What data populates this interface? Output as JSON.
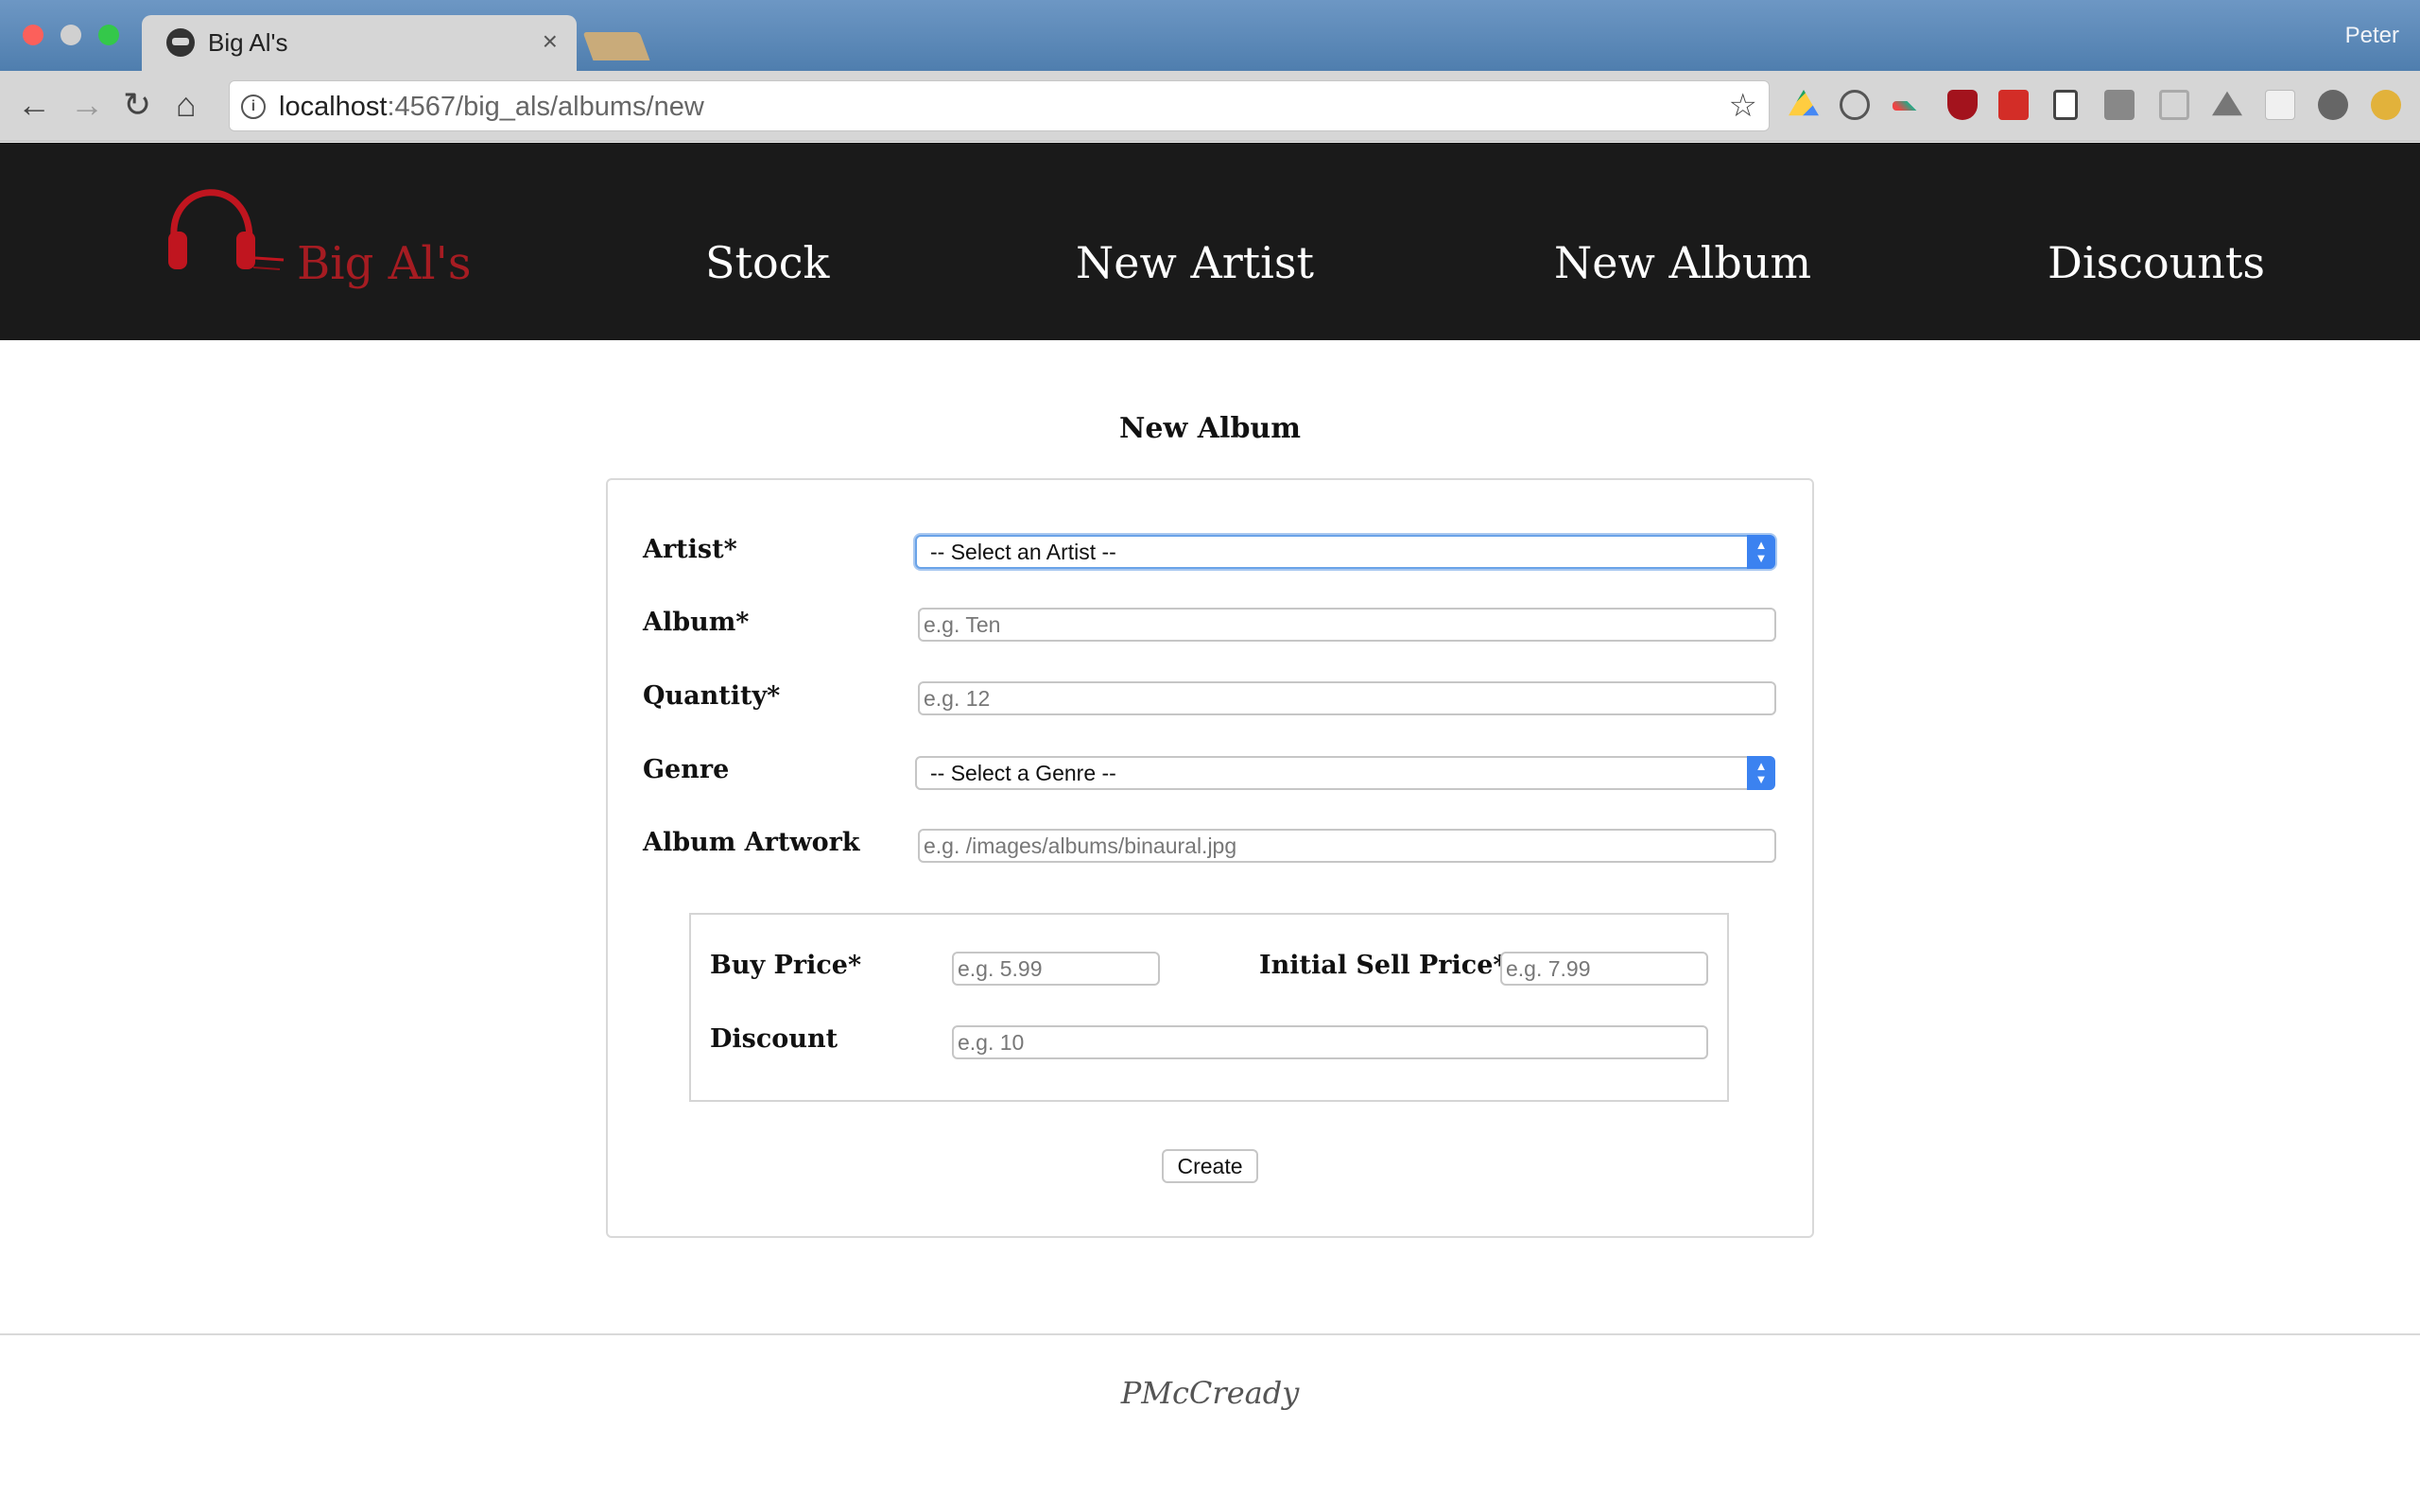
{
  "browser": {
    "tab_title": "Big Al's",
    "tab_close": "×",
    "profile_name": "Peter",
    "url_host": "localhost",
    "url_path": ":4567/big_als/albums/new",
    "nav": {
      "back": "←",
      "forward": "→",
      "reload": "↻",
      "home": "⌂",
      "info": "i",
      "star": "☆"
    },
    "extension_icons": [
      "google-drive-icon",
      "dashlane-icon",
      "feather-icon",
      "ublock-icon",
      "lastpass-icon",
      "document-icon",
      "calendar-icon",
      "cast-icon",
      "drive-alt-icon",
      "puzzle-icon",
      "gear-icon",
      "warning-icon"
    ]
  },
  "site": {
    "brand": "Big Al's",
    "nav": [
      "Stock",
      "New Artist",
      "New Album",
      "Discounts"
    ]
  },
  "form": {
    "title": "New Album",
    "artist_label": "Artist*",
    "artist_select": "-- Select an Artist --",
    "album_label": "Album*",
    "album_placeholder": "e.g. Ten",
    "quantity_label": "Quantity*",
    "quantity_placeholder": "e.g. 12",
    "genre_label": "Genre",
    "genre_select": "-- Select a Genre --",
    "artwork_label": "Album Artwork",
    "artwork_placeholder": "e.g. /images/albums/binaural.jpg",
    "buy_price_label": "Buy Price*",
    "buy_price_placeholder": "e.g. 5.99",
    "sell_price_label": "Initial Sell Price*",
    "sell_price_placeholder": "e.g. 7.99",
    "discount_label": "Discount",
    "discount_placeholder": "e.g. 10",
    "create_label": "Create"
  },
  "footer": {
    "signature": "PMcCready"
  },
  "colors": {
    "brand_red": "#a61c22",
    "navbar_bg": "#1a1a1a",
    "select_accent": "#3b82f0"
  }
}
